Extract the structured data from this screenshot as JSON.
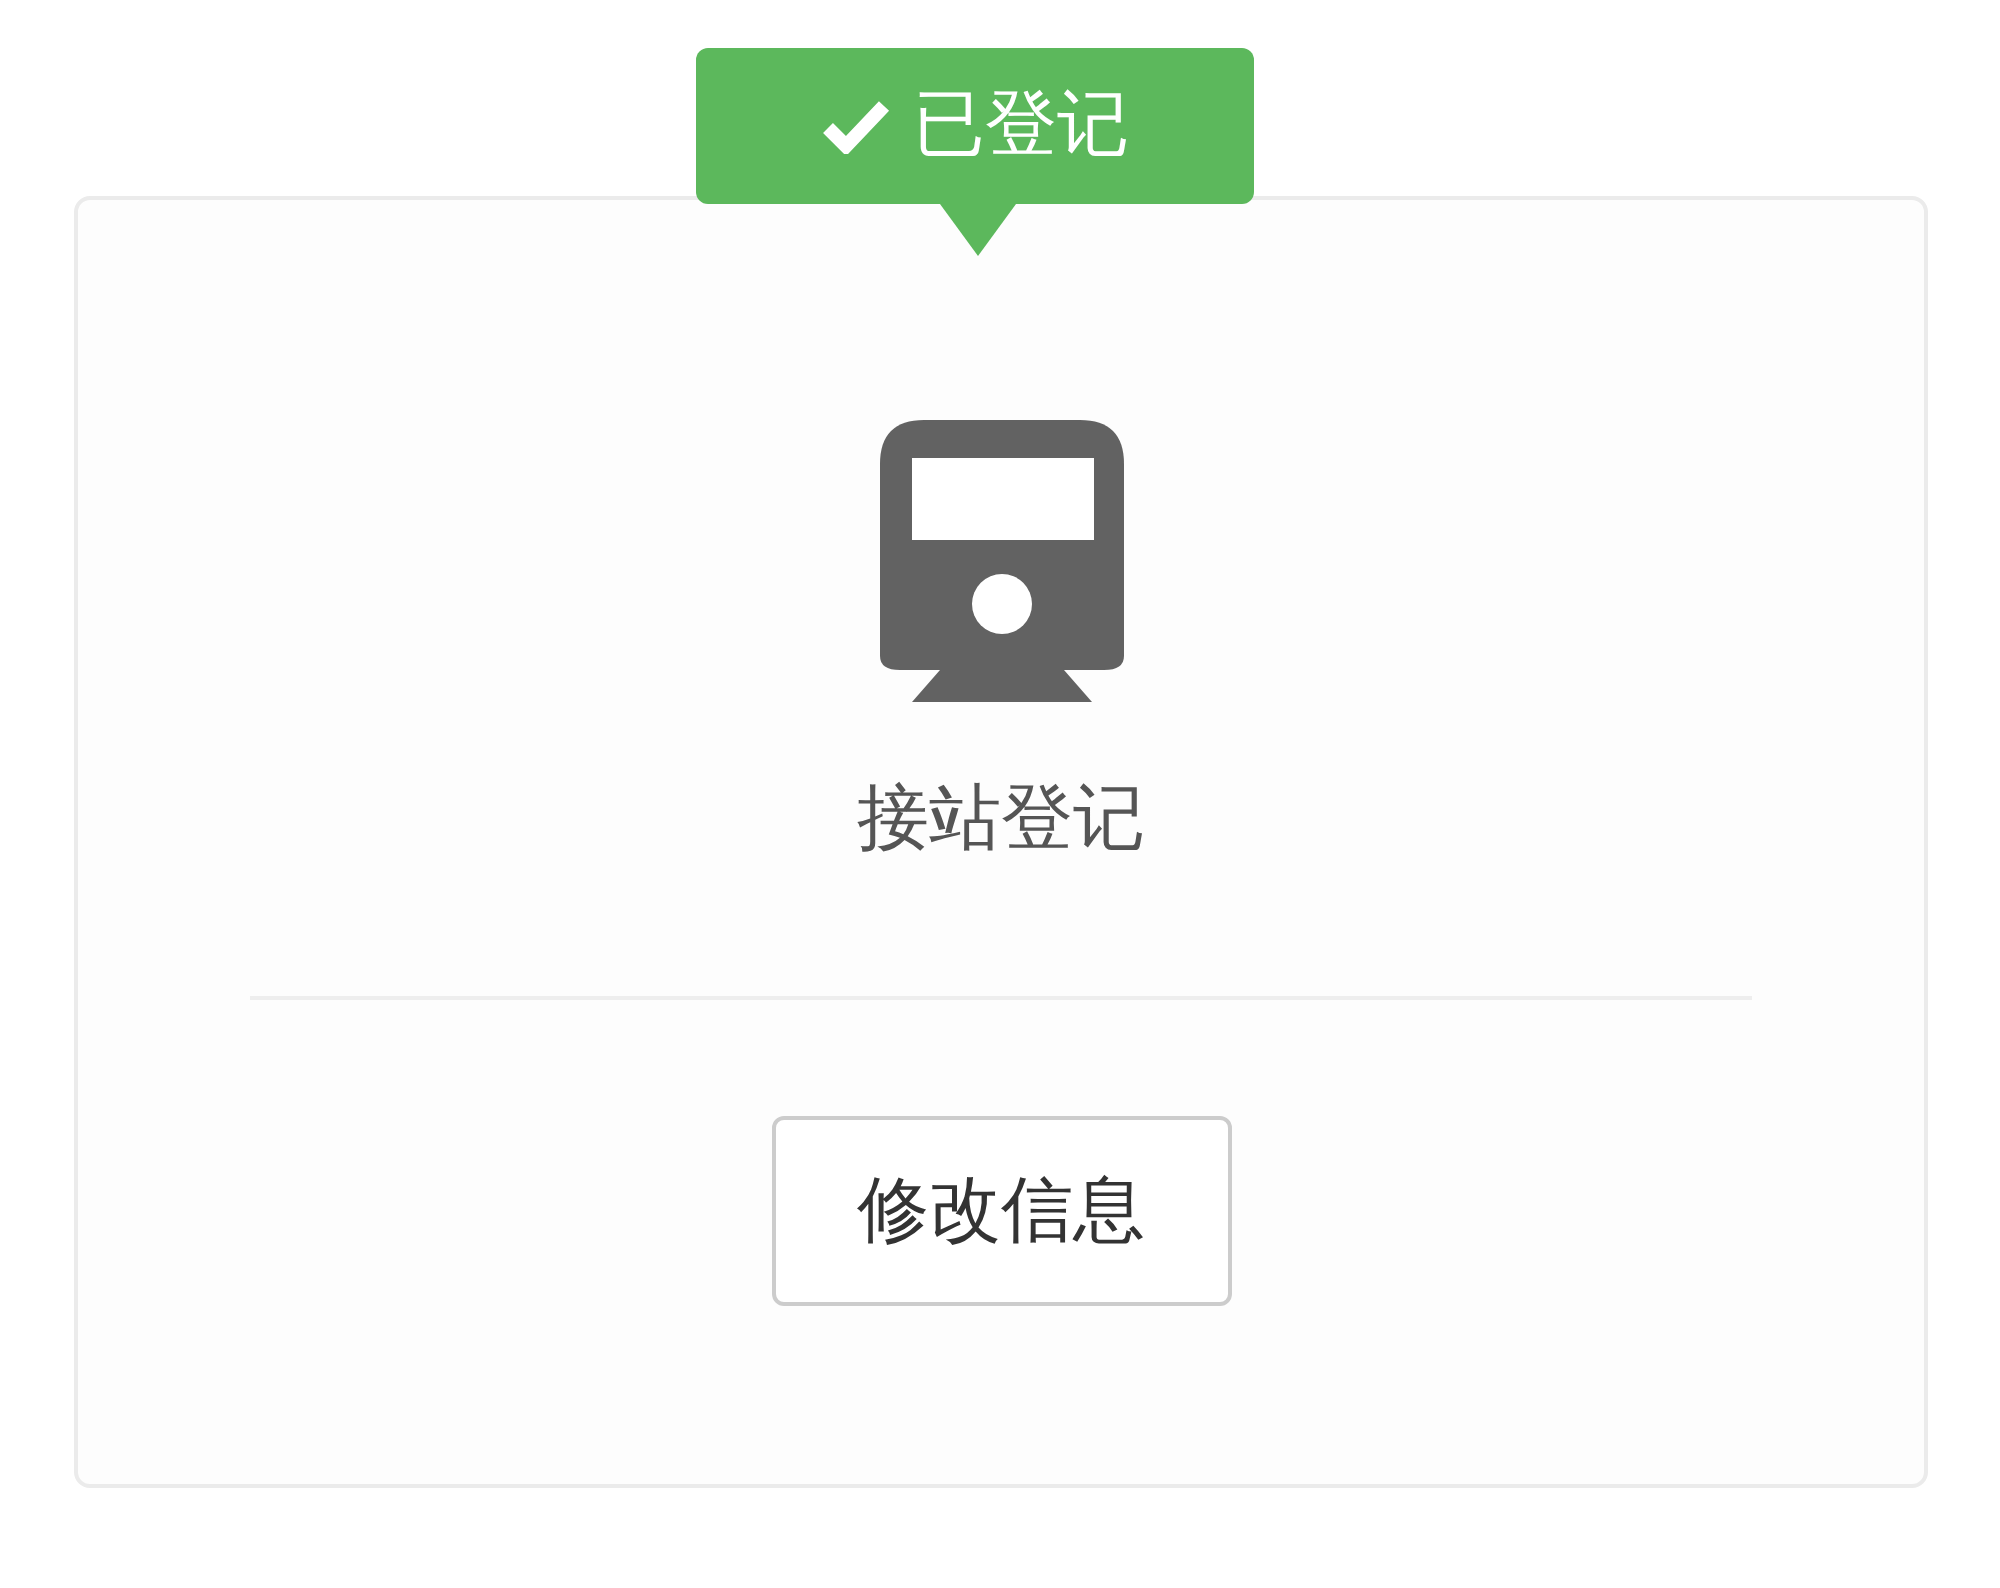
{
  "status_badge": {
    "label": "已登记",
    "kind": "success"
  },
  "title": "接站登记",
  "button": "修改信息"
}
